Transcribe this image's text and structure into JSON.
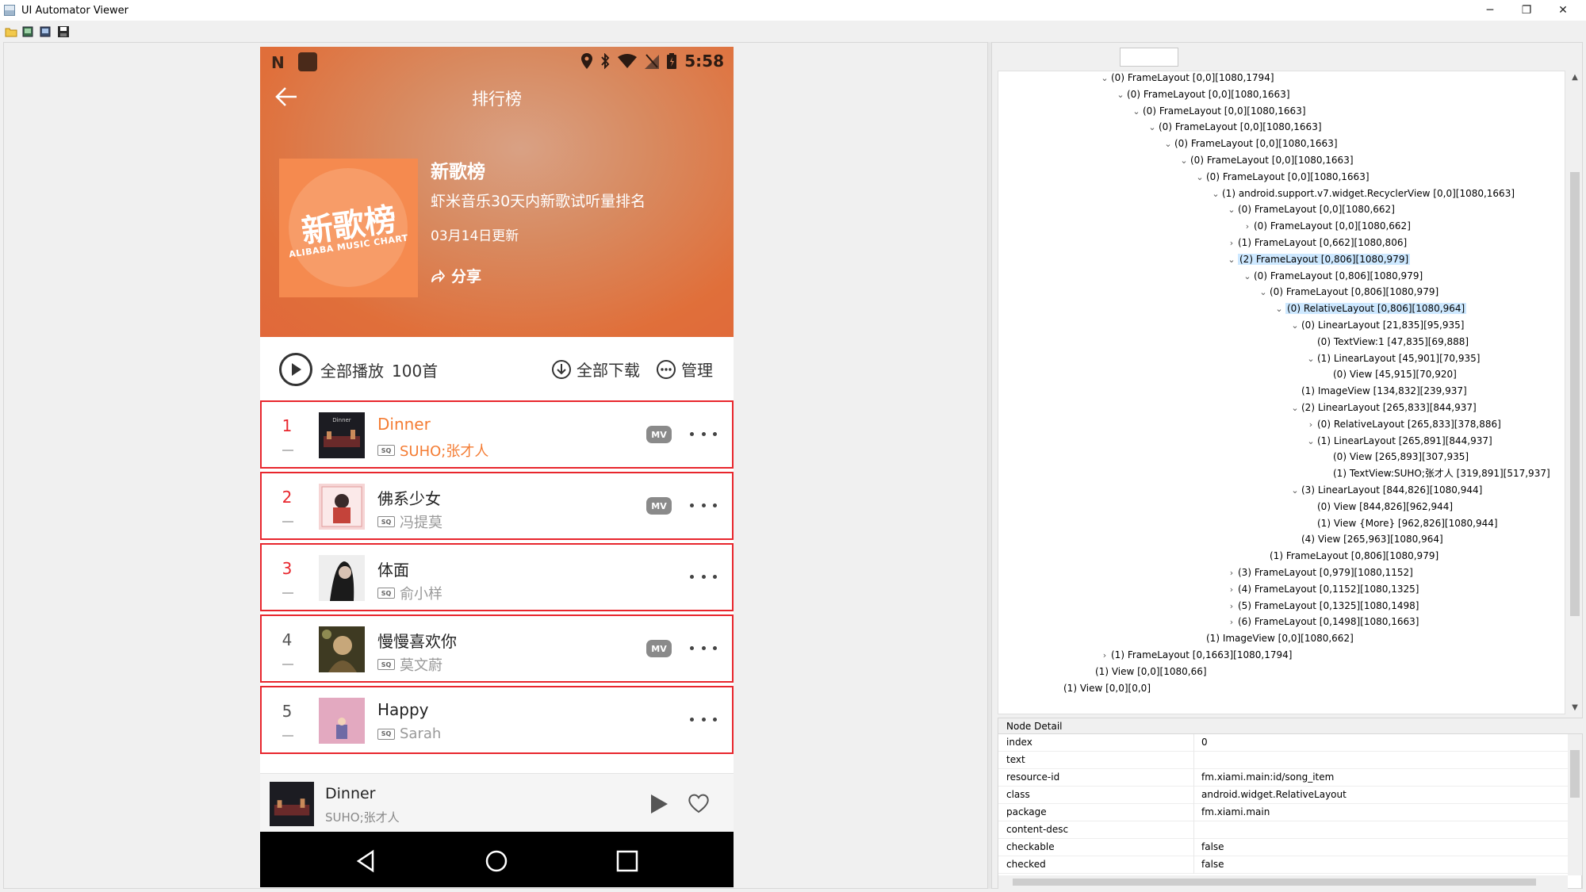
{
  "window": {
    "title": "UI Automator Viewer",
    "controls": {
      "minimize": "─",
      "restore": "❐",
      "close": "✕"
    }
  },
  "toolbar": {
    "icons": [
      "open-folder-icon",
      "screenshot-icon",
      "screenshot-compressed-icon",
      "save-icon"
    ]
  },
  "phone": {
    "status": {
      "time": "5:58",
      "left_logo": "N"
    },
    "appbar": {
      "title": "排行榜"
    },
    "chart": {
      "cover_title": "新歌榜",
      "cover_subtitle": "ALIBABA MUSIC CHART",
      "name": "新歌榜",
      "description": "虾米音乐30天内新歌试听量排名",
      "updated": "03月14日更新",
      "share_label": "分享"
    },
    "actions": {
      "play_all": "全部播放",
      "count": "100首",
      "download_all": "全部下载",
      "manage": "管理"
    },
    "songs": [
      {
        "rank": "1",
        "title": "Dinner",
        "artist": "SUHO;张才人",
        "has_mv": true,
        "highlight": true,
        "sq": "SQ",
        "mv_label": "MV"
      },
      {
        "rank": "2",
        "title": "佛系少女",
        "artist": "冯提莫",
        "has_mv": true,
        "highlight": false,
        "sq": "SQ",
        "mv_label": "MV"
      },
      {
        "rank": "3",
        "title": "体面",
        "artist": "俞小样",
        "has_mv": false,
        "highlight": false,
        "sq": "SQ",
        "mv_label": ""
      },
      {
        "rank": "4",
        "title": "慢慢喜欢你",
        "artist": "莫文蔚",
        "has_mv": true,
        "highlight": false,
        "sq": "SQ",
        "mv_label": "MV"
      },
      {
        "rank": "5",
        "title": "Happy",
        "artist": "Sarah",
        "has_mv": false,
        "highlight": false,
        "sq": "SQ",
        "mv_label": ""
      }
    ],
    "player": {
      "title": "Dinner",
      "artist": "SUHO;张才人"
    },
    "colors": {
      "accent": "#e8262d",
      "highlight_text": "#f47c33",
      "header": "#e1683a"
    }
  },
  "tree": {
    "nodes": [
      {
        "depth": 0,
        "arrow": "v",
        "text": "(0) FrameLayout [0,0][1080,1794]"
      },
      {
        "depth": 1,
        "arrow": "v",
        "text": "(0) FrameLayout [0,0][1080,1663]"
      },
      {
        "depth": 2,
        "arrow": "v",
        "text": "(0) FrameLayout [0,0][1080,1663]"
      },
      {
        "depth": 3,
        "arrow": "v",
        "text": "(0) FrameLayout [0,0][1080,1663]"
      },
      {
        "depth": 4,
        "arrow": "v",
        "text": "(0) FrameLayout [0,0][1080,1663]"
      },
      {
        "depth": 5,
        "arrow": "v",
        "text": "(0) FrameLayout [0,0][1080,1663]"
      },
      {
        "depth": 6,
        "arrow": "v",
        "text": "(0) FrameLayout [0,0][1080,1663]"
      },
      {
        "depth": 7,
        "arrow": "v",
        "text": "(1) android.support.v7.widget.RecyclerView [0,0][1080,1663]"
      },
      {
        "depth": 8,
        "arrow": "v",
        "text": "(0) FrameLayout [0,0][1080,662]"
      },
      {
        "depth": 9,
        "arrow": ">",
        "text": "(0) FrameLayout [0,0][1080,662]"
      },
      {
        "depth": 8,
        "arrow": ">",
        "text": "(1) FrameLayout [0,662][1080,806]"
      },
      {
        "depth": 8,
        "arrow": "v",
        "text": "(2) FrameLayout [0,806][1080,979]",
        "sel": true
      },
      {
        "depth": 9,
        "arrow": "v",
        "text": "(0) FrameLayout [0,806][1080,979]"
      },
      {
        "depth": 10,
        "arrow": "v",
        "text": "(0) FrameLayout [0,806][1080,979]"
      },
      {
        "depth": 11,
        "arrow": "v",
        "text": "(0) RelativeLayout [0,806][1080,964]",
        "sel": true
      },
      {
        "depth": 12,
        "arrow": "v",
        "text": "(0) LinearLayout [21,835][95,935]"
      },
      {
        "depth": 13,
        "arrow": "",
        "text": "(0) TextView:1 [47,835][69,888]"
      },
      {
        "depth": 13,
        "arrow": "v",
        "text": "(1) LinearLayout [45,901][70,935]"
      },
      {
        "depth": 14,
        "arrow": "",
        "text": "(0) View [45,915][70,920]"
      },
      {
        "depth": 12,
        "arrow": "",
        "text": "(1) ImageView [134,832][239,937]"
      },
      {
        "depth": 12,
        "arrow": "v",
        "text": "(2) LinearLayout [265,833][844,937]"
      },
      {
        "depth": 13,
        "arrow": ">",
        "text": "(0) RelativeLayout [265,833][378,886]"
      },
      {
        "depth": 13,
        "arrow": "v",
        "text": "(1) LinearLayout [265,891][844,937]"
      },
      {
        "depth": 14,
        "arrow": "",
        "text": "(0) View [265,893][307,935]"
      },
      {
        "depth": 14,
        "arrow": "",
        "text": "(1) TextView:SUHO;张才人 [319,891][517,937]"
      },
      {
        "depth": 12,
        "arrow": "v",
        "text": "(3) LinearLayout [844,826][1080,944]"
      },
      {
        "depth": 13,
        "arrow": "",
        "text": "(0) View [844,826][962,944]"
      },
      {
        "depth": 13,
        "arrow": "",
        "text": "(1) View {More} [962,826][1080,944]"
      },
      {
        "depth": 12,
        "arrow": "",
        "text": "(4) View [265,963][1080,964]"
      },
      {
        "depth": 10,
        "arrow": "",
        "text": "(1) FrameLayout [0,806][1080,979]"
      },
      {
        "depth": 8,
        "arrow": ">",
        "text": "(3) FrameLayout [0,979][1080,1152]"
      },
      {
        "depth": 8,
        "arrow": ">",
        "text": "(4) FrameLayout [0,1152][1080,1325]"
      },
      {
        "depth": 8,
        "arrow": ">",
        "text": "(5) FrameLayout [0,1325][1080,1498]"
      },
      {
        "depth": 8,
        "arrow": ">",
        "text": "(6) FrameLayout [0,1498][1080,1663]"
      },
      {
        "depth": 6,
        "arrow": "",
        "text": "(1) ImageView [0,0][1080,662]"
      },
      {
        "depth": 0,
        "arrow": ">",
        "text": "(1) FrameLayout [0,1663][1080,1794]"
      },
      {
        "depth": -1,
        "arrow": "",
        "text": "(1) View [0,0][1080,66]"
      },
      {
        "depth": -3,
        "arrow": "",
        "text": "(1) View [0,0][0,0]"
      }
    ]
  },
  "node_detail": {
    "header": "Node Detail",
    "rows": [
      {
        "key": "index",
        "value": "0"
      },
      {
        "key": "text",
        "value": ""
      },
      {
        "key": "resource-id",
        "value": "fm.xiami.main:id/song_item"
      },
      {
        "key": "class",
        "value": "android.widget.RelativeLayout"
      },
      {
        "key": "package",
        "value": "fm.xiami.main"
      },
      {
        "key": "content-desc",
        "value": ""
      },
      {
        "key": "checkable",
        "value": "false"
      },
      {
        "key": "checked",
        "value": "false"
      }
    ]
  }
}
